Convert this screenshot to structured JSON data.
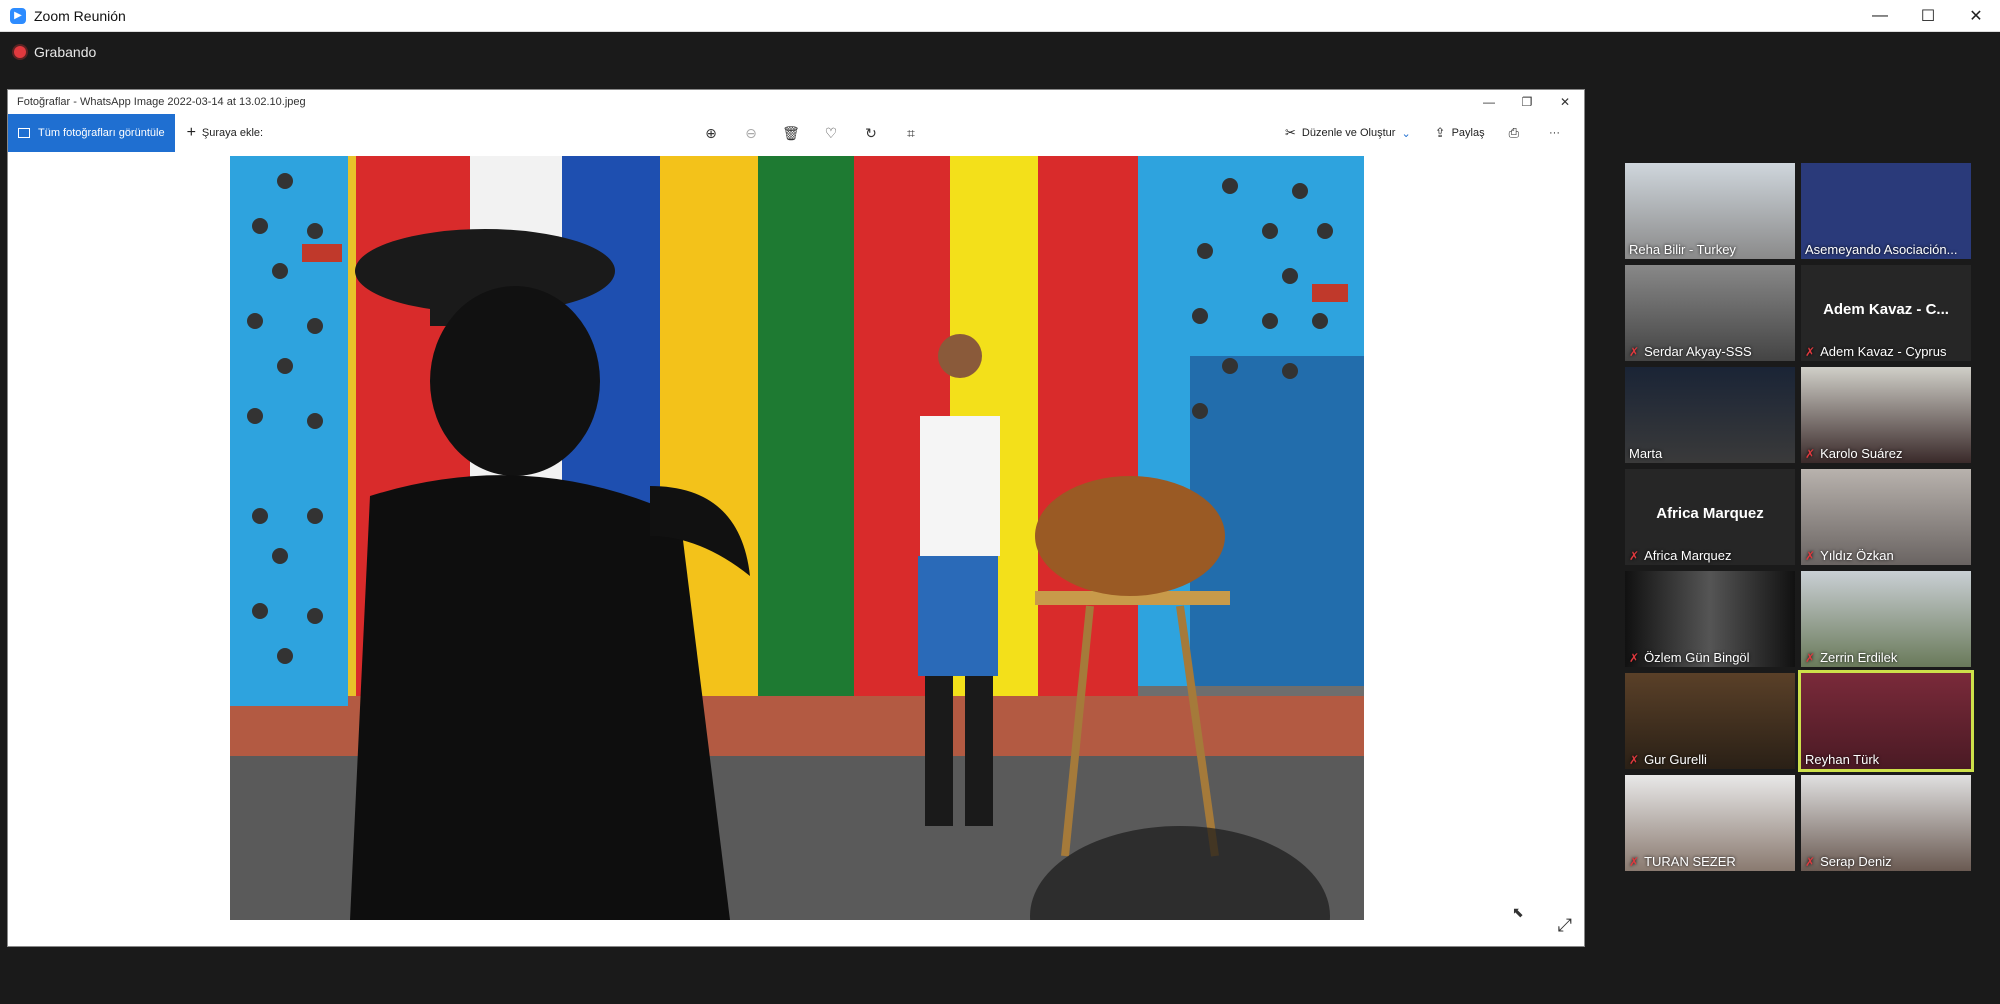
{
  "zoom": {
    "title": "Zoom Reunión",
    "window_controls": [
      "—",
      "☐",
      "✕"
    ],
    "recording_label": "Grabando"
  },
  "photos": {
    "title": "Fotoğraflar - WhatsApp Image 2022-03-14 at 13.02.10.jpeg",
    "view_all": "Tüm fotoğrafları görüntüle",
    "add_to": "Şuraya ekle:",
    "edit_create": "Düzenle ve Oluştur",
    "share": "Paylaş",
    "more": "···"
  },
  "participants": [
    {
      "name": "Reha Bilir - Turkey",
      "muted": false,
      "center_name": ""
    },
    {
      "name": "Asemeyando Asociación...",
      "muted": false,
      "center_name": ""
    },
    {
      "name": "Serdar Akyay-SSS",
      "muted": true,
      "center_name": ""
    },
    {
      "name": "Adem Kavaz - Cyprus",
      "muted": true,
      "center_name": "Adem Kavaz - C..."
    },
    {
      "name": "Marta",
      "muted": false,
      "center_name": ""
    },
    {
      "name": "Karolo Suárez",
      "muted": true,
      "center_name": ""
    },
    {
      "name": "Africa Marquez",
      "muted": true,
      "center_name": "Africa Marquez"
    },
    {
      "name": "Yıldız Özkan",
      "muted": true,
      "center_name": ""
    },
    {
      "name": "Özlem Gün Bingöl",
      "muted": true,
      "center_name": ""
    },
    {
      "name": "Zerrin Erdilek",
      "muted": true,
      "center_name": ""
    },
    {
      "name": "Gur Gurelli",
      "muted": true,
      "center_name": ""
    },
    {
      "name": "Reyhan Türk",
      "muted": false,
      "center_name": ""
    },
    {
      "name": "TURAN SEZER",
      "muted": true,
      "center_name": ""
    },
    {
      "name": "Serap Deniz",
      "muted": true,
      "center_name": ""
    }
  ],
  "colors": {
    "accent": "#1f6fd1",
    "active_speaker": "#cde04a",
    "recording": "#e0393e"
  }
}
